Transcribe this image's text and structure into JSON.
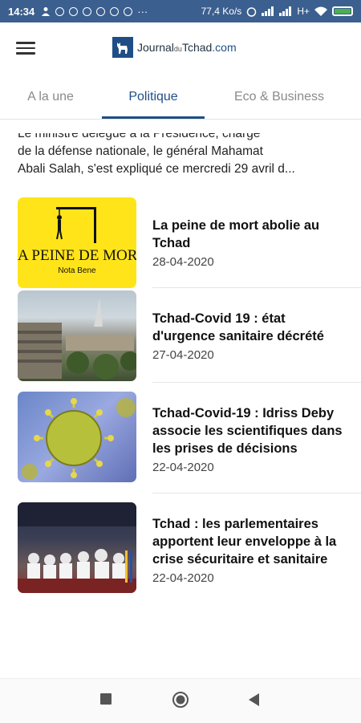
{
  "status_bar": {
    "time": "14:34",
    "network_speed": "77,4 Ko/s",
    "network_type": "H+"
  },
  "app": {
    "logo_main": "Journal",
    "logo_du": "du",
    "logo_tchad": "Tchad",
    "logo_domain": ".com",
    "brand_color": "#1f4e87"
  },
  "tabs": [
    {
      "label": "A la une",
      "active": false
    },
    {
      "label": "Politique",
      "active": true
    },
    {
      "label": "Eco & Business",
      "active": false
    }
  ],
  "excerpt": {
    "line1": "Le ministre délégué à la Présidence, chargé",
    "line2": "de la défense nationale, le général Mahamat",
    "line3": "Abali Salah, s'est expliqué ce mercredi 29 avril d..."
  },
  "articles": [
    {
      "title": "La peine de mort abolie au Tchad",
      "date": "28-04-2020",
      "thumb_text": "A PEINE DE MORT",
      "thumb_sub": "Nota Bene"
    },
    {
      "title": "Tchad-Covid 19 : état d'urgence sanitaire décrété",
      "date": "27-04-2020"
    },
    {
      "title": "Tchad-Covid-19 : Idriss Deby associe les scientifiques dans les prises de décisions",
      "date": "22-04-2020"
    },
    {
      "title": "Tchad : les parlementaires apportent leur enveloppe à la crise sécuritaire et sanitaire",
      "date": "22-04-2020"
    }
  ]
}
